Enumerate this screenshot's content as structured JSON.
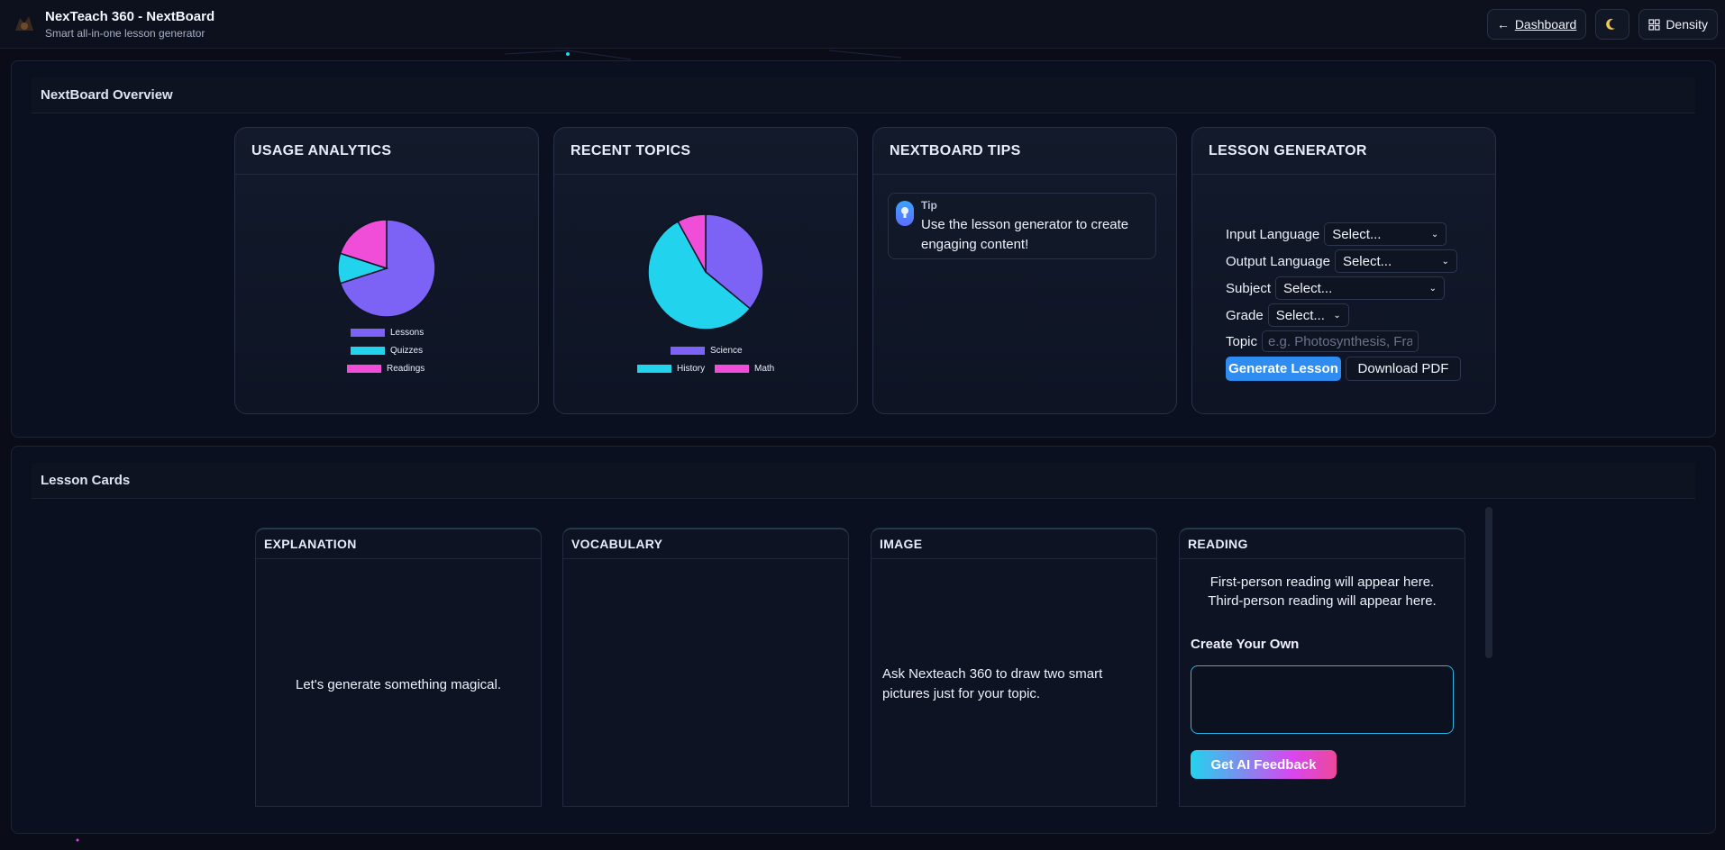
{
  "header": {
    "title": "NexTeach 360 - NextBoard",
    "subtitle": "Smart all-in-one lesson generator",
    "dashboard_label": "Dashboard",
    "theme_icon": "moon-icon",
    "density_label": "Density"
  },
  "overview": {
    "title": "NextBoard Overview",
    "usage": {
      "title": "USAGE ANALYTICS",
      "chart_data": {
        "type": "pie",
        "title": "",
        "categories": [
          "Lessons",
          "Quizzes",
          "Readings"
        ],
        "values": [
          70,
          10,
          20
        ],
        "colors": [
          "#7c63f5",
          "#22d3ee",
          "#f04ed8"
        ],
        "legend_position": "bottom"
      }
    },
    "topics": {
      "title": "RECENT TOPICS",
      "chart_data": {
        "type": "pie",
        "title": "",
        "categories": [
          "Science",
          "History",
          "Math"
        ],
        "values": [
          36,
          56,
          8
        ],
        "colors": [
          "#7c63f5",
          "#22d3ee",
          "#f04ed8"
        ],
        "legend_position": "bottom"
      }
    },
    "tips": {
      "title": "NEXTBOARD TIPS",
      "tip_label": "Tip",
      "tip_text": "Use the lesson generator to create engaging content!"
    },
    "generator": {
      "title": "LESSON GENERATOR",
      "input_language_label": "Input Language",
      "input_language_value": "Select...",
      "output_language_label": "Output Language",
      "output_language_value": "Select...",
      "subject_label": "Subject",
      "subject_value": "Select...",
      "grade_label": "Grade",
      "grade_value": "Select...",
      "topic_label": "Topic",
      "topic_placeholder": "e.g. Photosynthesis, Fra",
      "generate_label": "Generate Lesson",
      "download_label": "Download PDF"
    }
  },
  "lesson_cards": {
    "title": "Lesson Cards",
    "explanation": {
      "title": "EXPLANATION",
      "text": "Let's generate something magical."
    },
    "vocabulary": {
      "title": "VOCABULARY"
    },
    "image": {
      "title": "IMAGE",
      "text": "Ask Nexteach 360 to draw two smart pictures just for your topic."
    },
    "reading": {
      "title": "READING",
      "first_person": "First-person reading will appear here.",
      "third_person": "Third-person reading will appear here.",
      "create_label": "Create Your Own",
      "feedback_label": "Get AI Feedback"
    }
  }
}
